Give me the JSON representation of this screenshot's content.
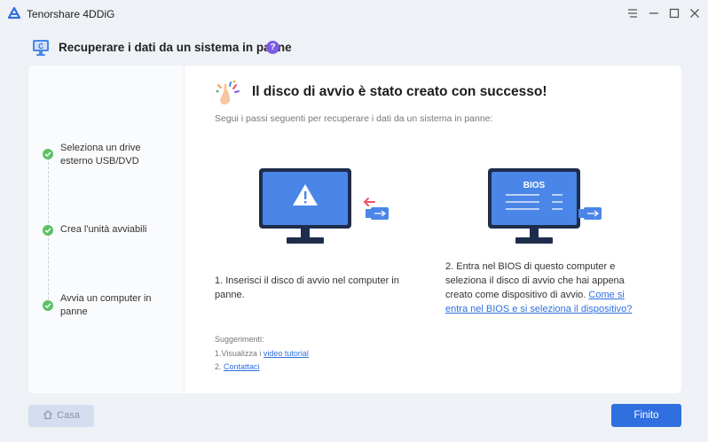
{
  "app": {
    "name": "Tenorshare 4DDiG"
  },
  "header": {
    "title": "Recuperare i dati da un sistema in panne",
    "help": "?"
  },
  "sidebar": {
    "steps": [
      {
        "label": "Seleziona un drive esterno USB/DVD",
        "done": true
      },
      {
        "label": "Crea l'unità avviabili",
        "done": true
      },
      {
        "label": "Avvia un computer in panne",
        "done": true
      }
    ]
  },
  "main": {
    "title": "Il disco di avvio è stato creato con successo!",
    "subtitle": "Segui i passi seguenti per recuperare i dati da un sistema in panne:",
    "step1": {
      "text": "1. Inserisci il disco di avvio nel computer in panne."
    },
    "step2": {
      "text": "2. Entra nel BIOS di questo computer e seleziona il disco di avvio che hai appena creato come dispositivo di avvio.",
      "link": "Come si entra nel BIOS e si seleziona il dispositivo?",
      "bios_label": "BIOS"
    },
    "tips": {
      "heading": "Suggerimenti:",
      "item1_prefix": "1.Visualizza i",
      "item1_link": "video tutorial",
      "item2_prefix": "2.",
      "item2_link": "Contattaci"
    }
  },
  "footer": {
    "home_label": "Casa",
    "finish_label": "Finito"
  },
  "colors": {
    "accent": "#2f6fe0",
    "success": "#5cc166",
    "help": "#7d5ce6",
    "monitor": "#4a86e8",
    "monitor_frame": "#1f2d4c"
  }
}
